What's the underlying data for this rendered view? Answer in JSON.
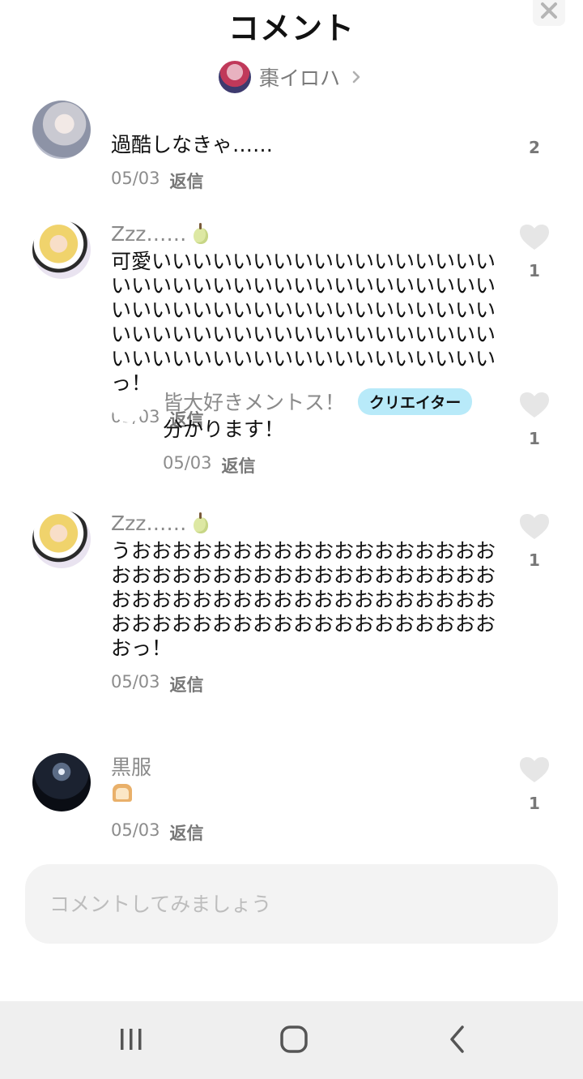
{
  "header": {
    "title": "コメント",
    "creator_name": "棗イロハ"
  },
  "comments": [
    {
      "user": "",
      "text": "過酷しなきゃ……",
      "date": "05/03",
      "reply_label": "返信",
      "likes": "2"
    },
    {
      "user": "Zzz……",
      "text": "可愛いいいいいいいいいいいいいいいいいいいいいいいいいいいいいいいいいいいいいいいいいいいいいいいいいいいいいいいいいいいいいいいいいいいいいいいいいいいいいいいいいいいいいいいいいいいいいっ！",
      "date": "05/03",
      "reply_label": "返信",
      "likes": "1"
    },
    {
      "user": "皆大好きメントス！",
      "badge": "クリエイター",
      "avatar_text": "",
      "text": "分かります！",
      "date": "05/03",
      "reply_label": "返信",
      "likes": "1"
    },
    {
      "user": "Zzz……",
      "text": "うおおおおおおおおおおおおおおおおおおおおおおおおおおおおおおおおおおおおおおおおおおおおおおおおおおおおおおおおおおおおおおおおおおおおおおおおおおおおっ！",
      "date": "05/03",
      "reply_label": "返信",
      "likes": "1"
    },
    {
      "user": "黒服",
      "text": "",
      "date": "05/03",
      "reply_label": "返信",
      "likes": "1"
    }
  ],
  "input": {
    "placeholder": "コメントしてみましょう"
  },
  "icons": {
    "close": "close-icon",
    "chevron": "chevron-right-icon",
    "like": "heart-icon",
    "pear": "pear-emoji",
    "bread": "bread-emoji",
    "nav_recents": "recents-icon",
    "nav_home": "home-icon",
    "nav_back": "back-icon"
  },
  "colors": {
    "badge_bg": "#b8eaf9",
    "like_gray": "#e6e6e6",
    "navbar_bg": "#efefef"
  }
}
